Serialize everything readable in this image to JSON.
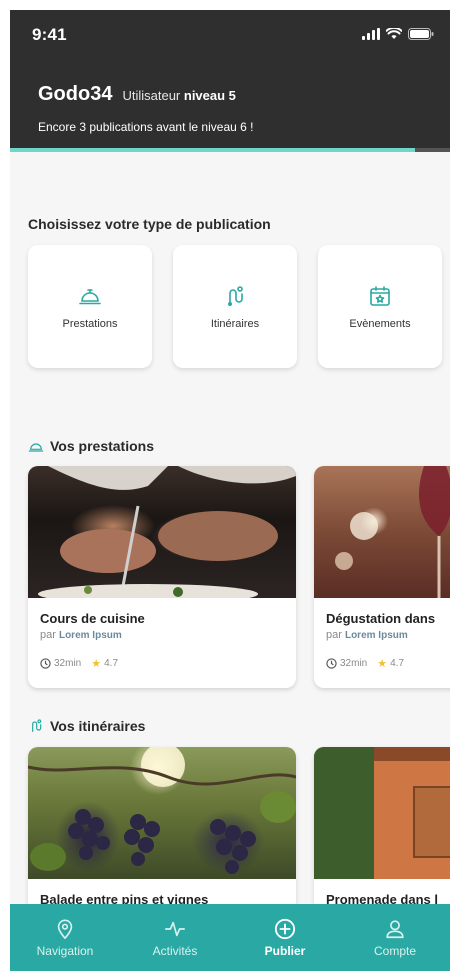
{
  "colors": {
    "accent": "#2aa8a3",
    "header_bg": "#2f2f2f",
    "progress": "#6fd6c9",
    "star": "#f2c12e"
  },
  "status_bar": {
    "time": "9:41"
  },
  "user": {
    "name": "Godo34",
    "level_prefix": "Utilisateur",
    "level_value": "niveau 5",
    "progress_text": "Encore 3 publications avant le niveau 6 !",
    "progress_fraction": 0.92
  },
  "choose": {
    "title": "Choisissez votre type de publication",
    "types": [
      {
        "label": "Prestations",
        "icon": "cloche-icon"
      },
      {
        "label": "Itinéraires",
        "icon": "route-icon"
      },
      {
        "label": "Evènements",
        "icon": "calendar-icon"
      }
    ]
  },
  "prestations": {
    "title": "Vos prestations",
    "icon": "cloche-icon",
    "cards": [
      {
        "title": "Cours de cuisine",
        "by": "par",
        "author": "Lorem Ipsum",
        "duration": "32min",
        "rating": "4.7"
      },
      {
        "title": "Dégustation dans",
        "by": "par",
        "author": "Lorem Ipsum",
        "duration": "32min",
        "rating": "4.7"
      }
    ]
  },
  "itineraires": {
    "title": "Vos itinéraires",
    "icon": "route-icon",
    "cards": [
      {
        "title": "Balade entre pins et vignes"
      },
      {
        "title": "Promenade dans l"
      }
    ]
  },
  "nav": [
    {
      "label": "Navigation",
      "icon": "map-pin-icon"
    },
    {
      "label": "Activités",
      "icon": "activity-icon"
    },
    {
      "label": "Publier",
      "icon": "plus-circle-icon",
      "active": true
    },
    {
      "label": "Compte",
      "icon": "user-icon"
    }
  ]
}
